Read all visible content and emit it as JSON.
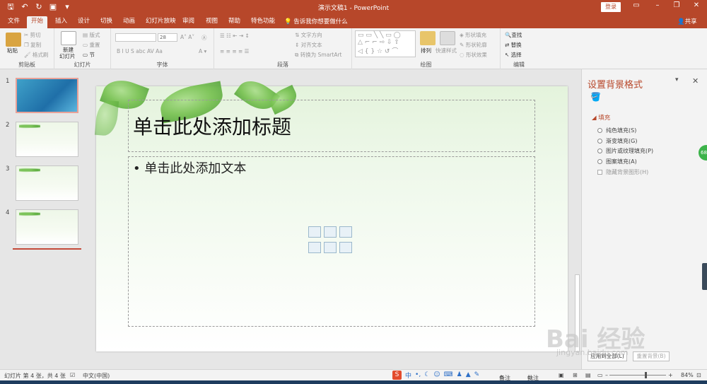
{
  "window": {
    "doc_title": "演示文稿1 - PowerPoint",
    "login": "登录"
  },
  "tabs": [
    "文件",
    "开始",
    "插入",
    "设计",
    "切换",
    "动画",
    "幻灯片放映",
    "审阅",
    "视图",
    "帮助",
    "特色功能"
  ],
  "tell_me": "告诉我你想要做什么",
  "share": "共享",
  "ribbon": {
    "clipboard": {
      "label": "剪贴板",
      "paste": "粘贴",
      "cut": "剪切",
      "copy": "复制",
      "format_painter": "格式刷"
    },
    "slides": {
      "label": "幻灯片",
      "new_slide": "新建",
      "new_slide2": "幻灯片",
      "layout": "版式",
      "reset": "重置",
      "section": "节"
    },
    "font": {
      "label": "字体",
      "size": "28"
    },
    "paragraph": {
      "label": "段落",
      "text_direction": "文字方向",
      "align_text": "对齐文本",
      "smartart": "转换为 SmartArt"
    },
    "drawing": {
      "label": "绘图",
      "arrange": "排列",
      "quick_styles": "快速样式",
      "shape_fill": "形状填充",
      "shape_outline": "形状轮廓",
      "shape_effects": "形状效果"
    },
    "editing": {
      "label": "编辑",
      "find": "查找",
      "replace": "替换",
      "select": "选择"
    }
  },
  "thumbnails": [
    "1",
    "2",
    "3",
    "4"
  ],
  "slide": {
    "title_placeholder": "单击此处添加标题",
    "body_placeholder": "• 单击此处添加文本"
  },
  "pane": {
    "title": "设置背景格式",
    "section": "填充",
    "options": [
      "纯色填充(S)",
      "渐变填充(G)",
      "图片或纹理填充(P)",
      "图案填充(A)"
    ],
    "hide_bg": "隐藏背景图形(H)",
    "apply_all": "应用到全部(L)",
    "reset_bg": "重置背景(B)"
  },
  "status": {
    "slide_info": "幻灯片 第 4 张，共 4 张",
    "language": "中文(中国)",
    "notes": "备注",
    "comments": "批注",
    "zoom": "84%"
  },
  "ime": {
    "logo": "S",
    "mode": "中"
  },
  "watermark": {
    "main": "Bai 经验",
    "sub": "jingyan.baidu.com"
  },
  "badge": "68",
  "colors": {
    "accent": "#b7472a"
  }
}
